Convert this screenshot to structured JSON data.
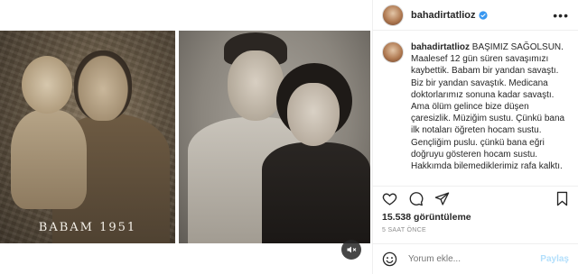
{
  "media": {
    "left_caption": "BABAM 1951",
    "mute_icon": "speaker-muted-icon"
  },
  "header": {
    "username": "bahadirtatlioz",
    "verified_icon": "verified-badge-icon",
    "more_icon": "more-dots-icon",
    "more_text": "•••"
  },
  "caption": {
    "username": "bahadirtatlioz",
    "text": "BAŞIMIZ SAĞOLSUN. Maalesef 12 gün süren savaşımızı kaybettik. Babam bir yandan savaştı. Biz bir yandan savaştık. Medicana doktorlarımız sonuna kadar savaştı. Ama ölüm gelince bize düşen çaresizlik. Müziğim sustu. Çünkü bana ilk notaları öğreten hocam sustu. Gençliğim puslu. çünkü bana eğri doğruyu gösteren hocam sustu. Hakkımda bilemediklerimiz rafa kalktı."
  },
  "actions": {
    "like_icon": "heart-icon",
    "comment_icon": "comment-bubble-icon",
    "share_icon": "paper-plane-icon",
    "save_icon": "bookmark-icon"
  },
  "stats": {
    "views": "15.538 görüntüleme",
    "time": "5 SAAT ÖNCE"
  },
  "comment_box": {
    "emoji_icon": "smiley-icon",
    "placeholder": "Yorum ekle...",
    "submit_label": "Paylaş"
  },
  "colors": {
    "verified": "#3897f0",
    "border": "#efefef",
    "muted_text": "#8e8e8e",
    "submit_disabled": "#b2dffc"
  }
}
